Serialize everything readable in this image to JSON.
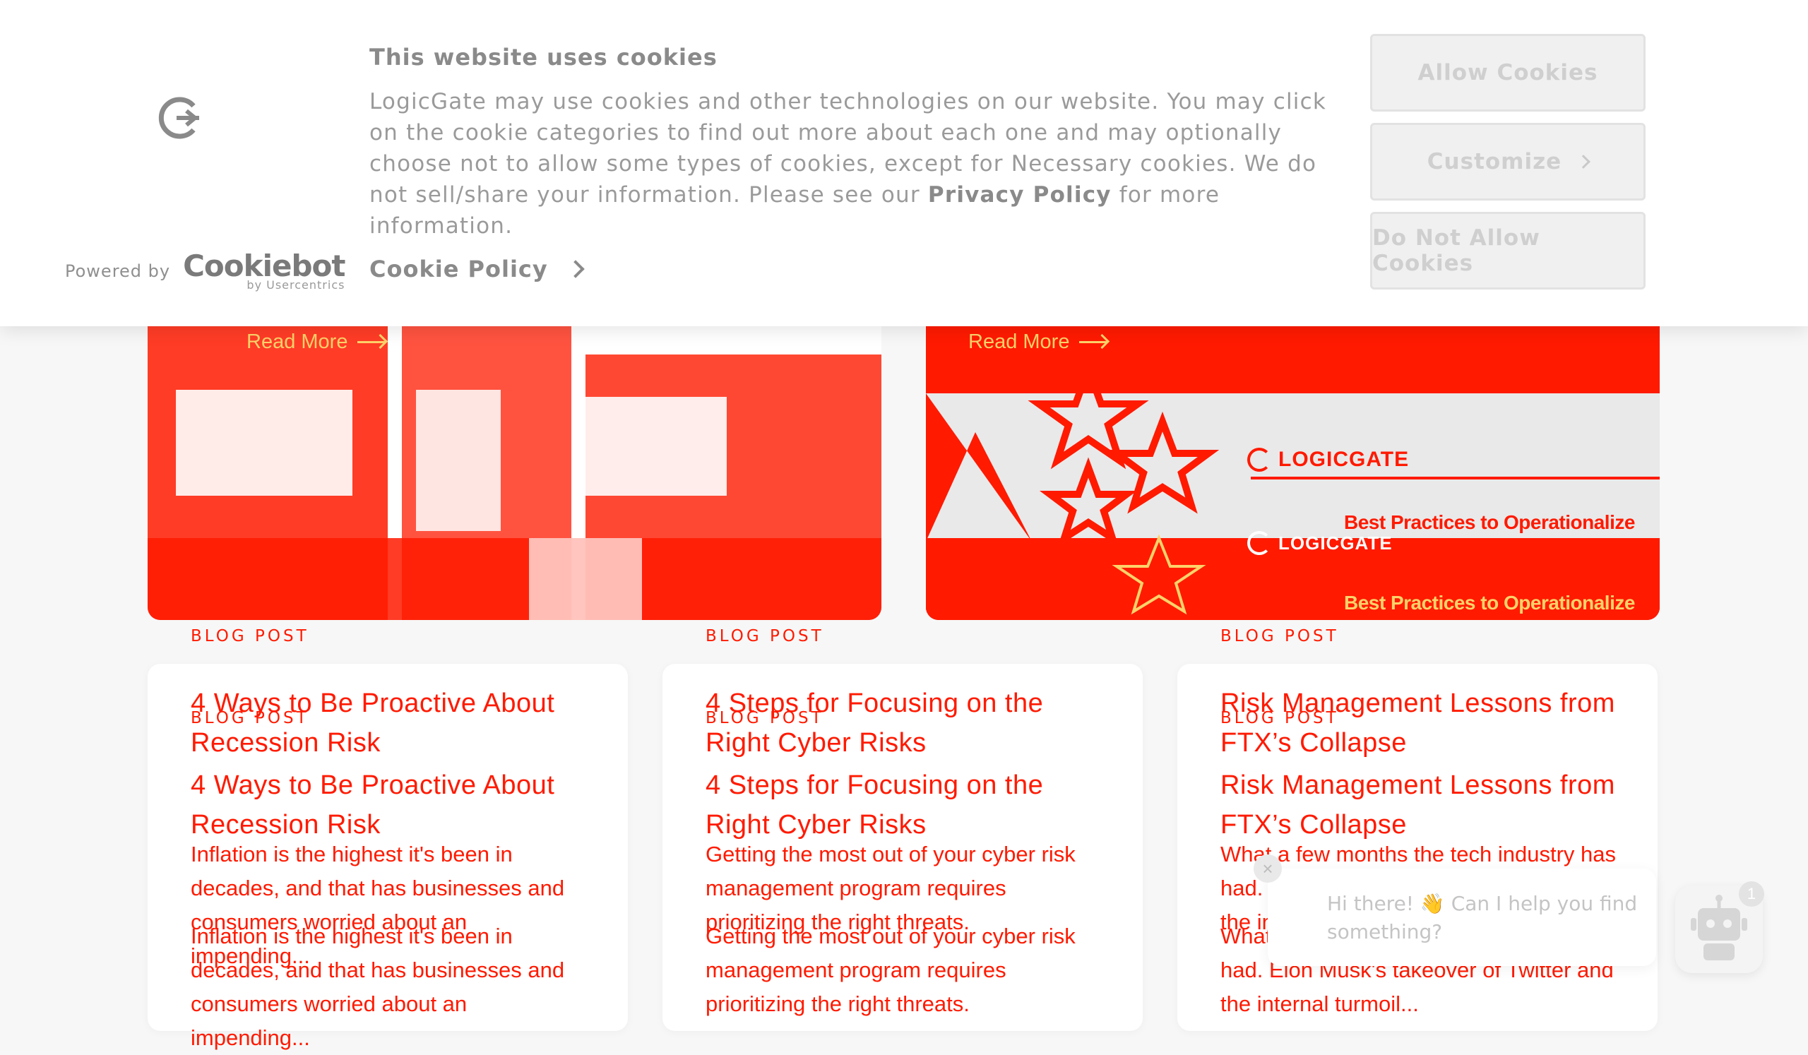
{
  "cookie_banner": {
    "title": "This website uses cookies",
    "body_text": "LogicGate may use cookies and other technologies on our website. You may click on the cookie categories to find out more about each one and may optionally choose not to allow some types of cookies, except for Necessary cookies.  We do not sell/share your information. Please see our ",
    "privacy_link": "Privacy Policy",
    "body_suffix": " for more information.",
    "cookie_policy_link": "Cookie Policy",
    "powered_by": "Powered by",
    "cookiebot_name": "Cookiebot",
    "cookiebot_sub": "by Usercentrics",
    "allow_button": "Allow Cookies",
    "customize_button": "Customize",
    "deny_button": "Do Not Allow Cookies"
  },
  "hero": {
    "left_read_more": "Read More",
    "right_read_more": "Read More",
    "brand_name": "LOGICGATE",
    "tagline": "Best Practices to Operationalize"
  },
  "cards": [
    {
      "category": "BLOG POST",
      "title": "4 Ways to Be Proactive About Recession Risk",
      "excerpt": "Inflation is the highest it's been in decades, and that has businesses and consumers worried about an impending..."
    },
    {
      "category": "BLOG POST",
      "title": "4 Steps for Focusing on the Right Cyber Risks",
      "excerpt": "Getting the most out of your cyber risk management program requires prioritizing the right threats."
    },
    {
      "category": "BLOG POST",
      "title": "Risk Management Lessons from FTX’s Collapse",
      "excerpt": "What a few months the tech industry has had.  Elon Musk's takeover of Twitter and the internal turmoil..."
    }
  ],
  "chat": {
    "message": "Hi there! 👋 Can I help you find something?",
    "close_glyph": "×",
    "badge_count": "1"
  },
  "colors": {
    "accent": "#ff1a00",
    "highlight": "#ffd26a",
    "muted_text": "#9a9a9a"
  }
}
